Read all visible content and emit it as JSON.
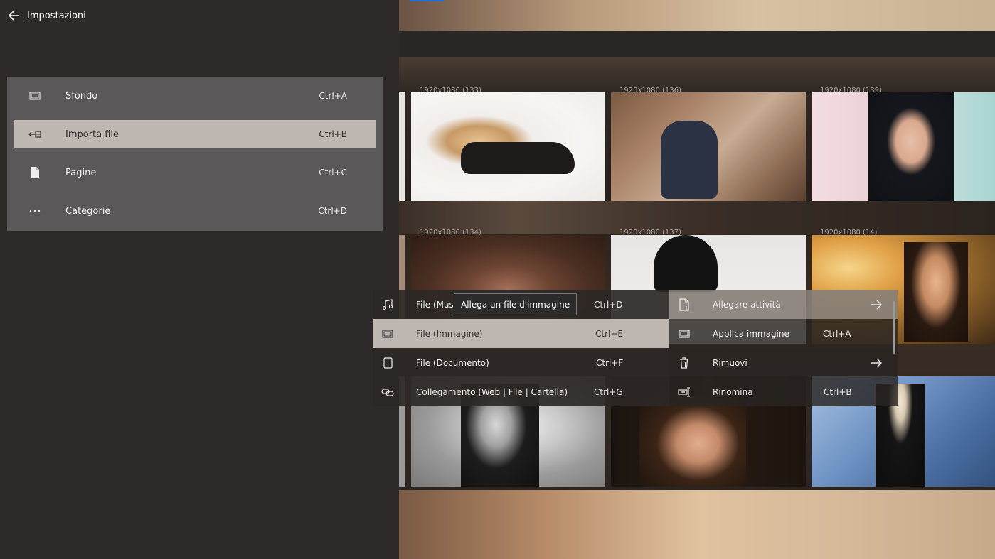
{
  "header": {
    "back_label": "Impostazioni",
    "back_icon": "back-arrow-icon"
  },
  "settings_menu": {
    "items": [
      {
        "label": "Sfondo",
        "shortcut": "Ctrl+A",
        "icon": "wallpaper-icon",
        "selected": false
      },
      {
        "label": "Importa file",
        "shortcut": "Ctrl+B",
        "icon": "import-icon",
        "selected": true
      },
      {
        "label": "Pagine",
        "shortcut": "Ctrl+C",
        "icon": "page-icon",
        "selected": false
      },
      {
        "label": "Categorie",
        "shortcut": "Ctrl+D",
        "icon": "more-icon",
        "selected": false
      }
    ]
  },
  "gallery": {
    "captions": [
      "1920x1080 (133)",
      "1920x1080 (136)",
      "1920x1080 (139)",
      "1920x1080 (134)",
      "1920x1080 (137)",
      "1920x1080 (14)"
    ]
  },
  "context_menu": {
    "left_items": [
      {
        "label": "File (Musica)",
        "shortcut": "Ctrl+D",
        "icon": "music-icon",
        "selected": false
      },
      {
        "label": "File (Immagine)",
        "shortcut": "Ctrl+E",
        "icon": "image-icon",
        "selected": true
      },
      {
        "label": "File (Documento)",
        "shortcut": "Ctrl+F",
        "icon": "document-icon",
        "selected": false
      },
      {
        "label": "Collegamento (Web | File | Cartella)",
        "shortcut": "Ctrl+G",
        "icon": "link-icon",
        "selected": false
      }
    ],
    "right_items": [
      {
        "label": "Allegare attività",
        "shortcut": "",
        "icon": "attach-file-icon",
        "has_arrow": true
      },
      {
        "label": "Applica immagine",
        "shortcut": "Ctrl+A",
        "icon": "apply-image-icon",
        "has_arrow": false
      },
      {
        "label": "Rimuovi",
        "shortcut": "",
        "icon": "trash-icon",
        "has_arrow": true
      },
      {
        "label": "Rinomina",
        "shortcut": "Ctrl+B",
        "icon": "rename-icon",
        "has_arrow": false
      }
    ]
  },
  "tooltip": {
    "text": "Allega un file d'immagine"
  }
}
